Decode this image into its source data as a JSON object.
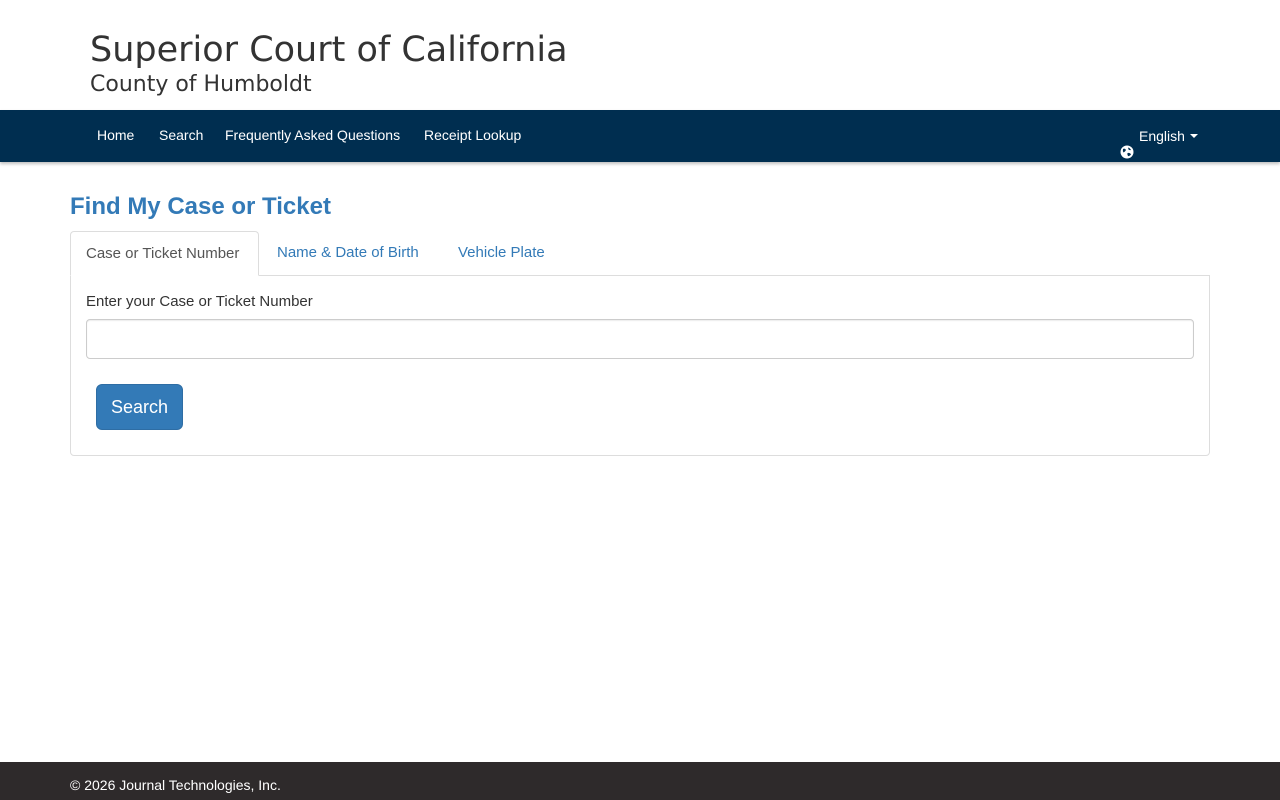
{
  "header": {
    "title": "Superior Court of California",
    "subtitle": "County of Humboldt"
  },
  "nav": {
    "items": [
      {
        "label": "Home"
      },
      {
        "label": "Search"
      },
      {
        "label": "Frequently Asked Questions"
      },
      {
        "label": "Receipt Lookup"
      }
    ],
    "language": {
      "label": "English",
      "icon": "globe-icon"
    }
  },
  "main": {
    "heading": "Find My Case or Ticket",
    "tabs": [
      {
        "label": "Case or Ticket Number",
        "active": true
      },
      {
        "label": "Name & Date of Birth",
        "active": false
      },
      {
        "label": "Vehicle Plate",
        "active": false
      }
    ],
    "form": {
      "field_label": "Enter your Case or Ticket Number",
      "input_value": "",
      "input_placeholder": "",
      "search_label": "Search"
    }
  },
  "footer": {
    "text": "© 2026 Journal Technologies, Inc."
  },
  "colors": {
    "navbar": "#002e50",
    "accent": "#337ab7",
    "footer": "#2e2a2b"
  }
}
